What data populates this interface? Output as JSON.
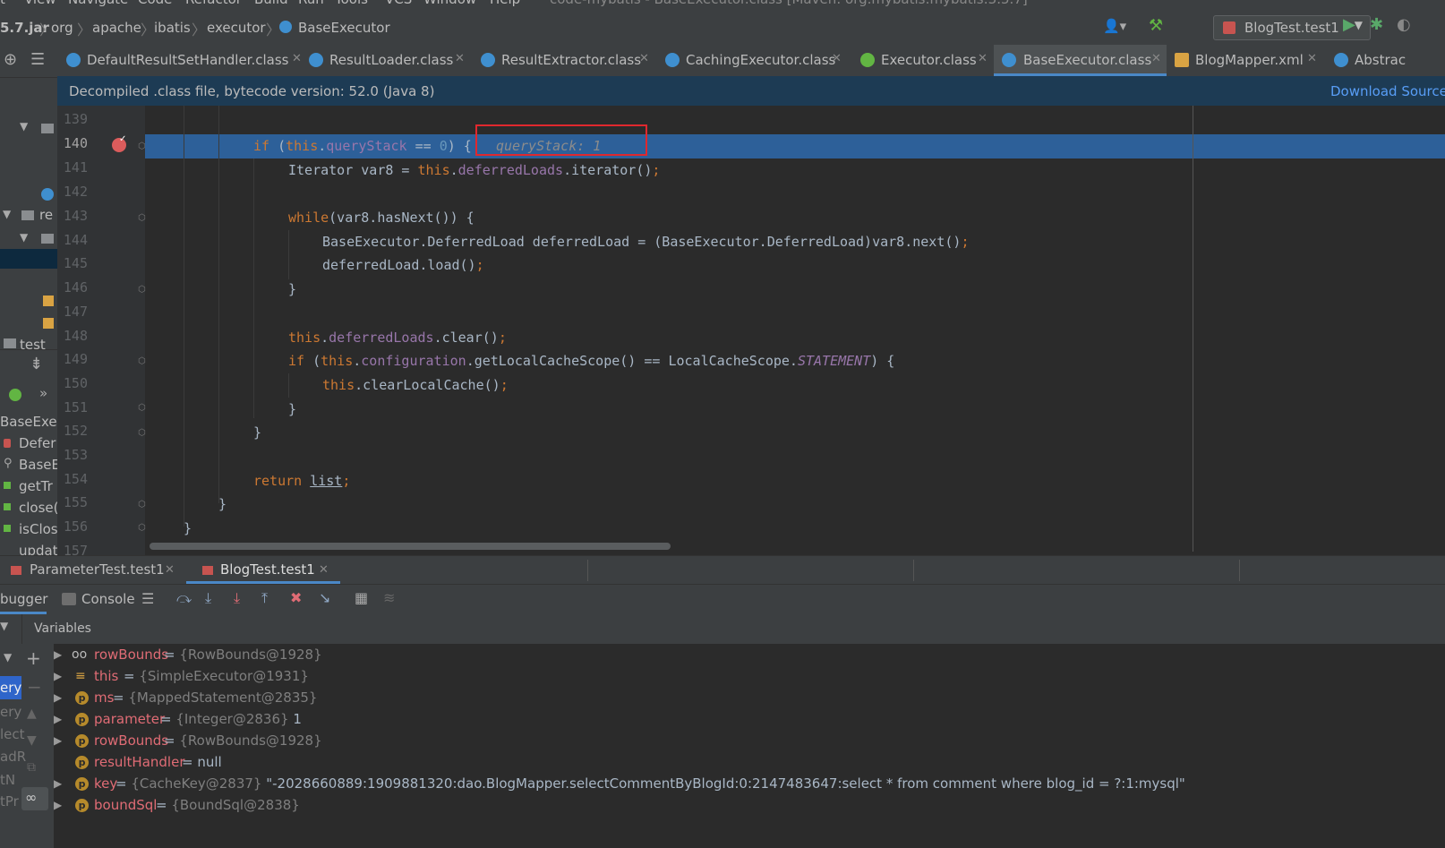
{
  "menu": {
    "items": [
      "t",
      "View",
      "Navigate",
      "Code",
      "Refactor",
      "Build",
      "Run",
      "Tools",
      "VCS",
      "Window",
      "Help"
    ],
    "window_title": "code-mybatis - BaseExecutor.class [Maven: org.mybatis:mybatis:3.5.7]"
  },
  "breadcrumb": [
    "5.7.jar",
    "org",
    "apache",
    "ibatis",
    "executor",
    "BaseExecutor"
  ],
  "run_config": "BlogTest.test1",
  "editor_tabs": [
    {
      "label": "DefaultResultSetHandler.class",
      "icon": "class-icon"
    },
    {
      "label": "ResultLoader.class",
      "icon": "class-icon"
    },
    {
      "label": "ResultExtractor.class",
      "icon": "class-icon"
    },
    {
      "label": "CachingExecutor.class",
      "icon": "class-icon"
    },
    {
      "label": "Executor.class",
      "icon": "interface-icon"
    },
    {
      "label": "BaseExecutor.class",
      "icon": "class-icon",
      "active": true
    },
    {
      "label": "BlogMapper.xml",
      "icon": "xml-icon"
    },
    {
      "label": "Abstrac",
      "icon": "class-icon"
    }
  ],
  "banner": {
    "message": "Decompiled .class file, bytecode version: 52.0 (Java 8)",
    "link": "Download Sources"
  },
  "code": {
    "line_numbers": [
      "139",
      "140",
      "141",
      "142",
      "143",
      "144",
      "145",
      "146",
      "147",
      "148",
      "149",
      "150",
      "151",
      "152",
      "153",
      "154",
      "155",
      "156",
      "157"
    ],
    "current_line": "140",
    "inline_hint": "queryStack: 1"
  },
  "project_panel": {
    "items": [
      "re",
      "test",
      "BaseExec",
      "Defer",
      "BaseE",
      "getTr",
      "close(",
      "isClos",
      "updat"
    ]
  },
  "debug": {
    "tabs": [
      "ParameterTest.test1",
      "BlogTest.test1"
    ],
    "active_tab": "BlogTest.test1",
    "toolbar": {
      "debugger_label": "bugger",
      "console_label": "Console"
    },
    "variables_header": "Variables",
    "side_labels": [
      "ery",
      "ery",
      "lect",
      "adR",
      "tN",
      "tPr"
    ],
    "variables": [
      {
        "name": "rowBounds",
        "eq": " = ",
        "type": "{RowBounds@1928}",
        "value": "",
        "icon": "oo",
        "expandable": true
      },
      {
        "name": "this",
        "eq": " = ",
        "type": "{SimpleExecutor@1931}",
        "value": "",
        "icon": "≡",
        "expandable": true
      },
      {
        "name": "ms",
        "eq": " = ",
        "type": "{MappedStatement@2835}",
        "value": "",
        "icon": "p",
        "expandable": true
      },
      {
        "name": "parameter",
        "eq": " = ",
        "type": "{Integer@2836}",
        "value": " 1",
        "icon": "p",
        "expandable": true
      },
      {
        "name": "rowBounds",
        "eq": " = ",
        "type": "{RowBounds@1928}",
        "value": "",
        "icon": "p",
        "expandable": true
      },
      {
        "name": "resultHandler",
        "eq": " = ",
        "type": "",
        "value": "null",
        "icon": "p",
        "expandable": false
      },
      {
        "name": "key",
        "eq": " = ",
        "type": "{CacheKey@2837}",
        "value": " \"-2028660889:1909881320:dao.BlogMapper.selectCommentByBlogId:0:2147483647:select * from comment where blog_id = ?:1:mysql\"",
        "icon": "p",
        "expandable": true
      },
      {
        "name": "boundSql",
        "eq": " = ",
        "type": "{BoundSql@2838}",
        "value": "",
        "icon": "p",
        "expandable": true
      }
    ]
  },
  "colors": {
    "accent": "#4a88c7",
    "highlight": "#2d6099",
    "keyword": "#cc7832",
    "field": "#9876aa",
    "number": "#6897bb",
    "red_box": "#e0282e"
  }
}
